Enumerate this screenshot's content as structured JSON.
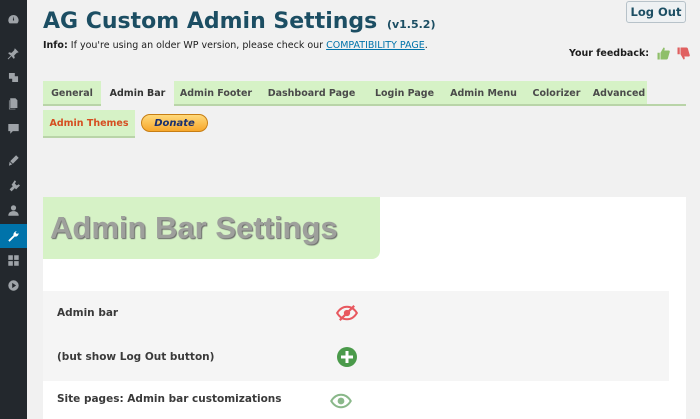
{
  "header": {
    "title": "AG Custom Admin Settings",
    "version": "(v1.5.2)",
    "info_label": "Info:",
    "info_text": " If you're using an older WP version, please check our ",
    "compat_link": "COMPATIBILITY PAGE",
    "info_end": ".",
    "logout_label": "Log Out",
    "feedback_label": "Your feedback:"
  },
  "sidebar": {
    "icons": [
      "dashboard-icon",
      "pin-icon",
      "media-icon",
      "pages-icon",
      "comments-icon",
      "appearance-icon",
      "plugins-icon",
      "users-icon",
      "tools-icon",
      "settings-icon",
      "play-icon"
    ],
    "active": "tools-icon"
  },
  "tabs": [
    {
      "label": "General"
    },
    {
      "label": "Admin Bar"
    },
    {
      "label": "Admin Footer"
    },
    {
      "label": "Dashboard Page"
    },
    {
      "label": "Login Page"
    },
    {
      "label": "Admin Menu"
    },
    {
      "label": "Colorizer"
    },
    {
      "label": "Advanced"
    }
  ],
  "active_tab": "Admin Bar",
  "tab_admin_themes": "Admin Themes",
  "donate_label": "Donate",
  "main": {
    "section_title": "Admin Bar Settings",
    "rows": [
      {
        "label": "Admin bar",
        "control": "hidden-eye-icon",
        "state": "hidden"
      },
      {
        "label": "(but show Log Out button)",
        "control": "plus-circle-icon",
        "state": "enabled"
      },
      {
        "label": "Site pages: Admin bar customizations",
        "control": "eye-icon",
        "state": "visible"
      }
    ]
  },
  "colors": {
    "accent_green": "#d6f2c6",
    "title_blue": "#1c4e63",
    "themes_orange": "#d54e21",
    "hidden_red": "#e8585f",
    "enabled_green": "#4a9a4a",
    "eye_green": "#8ab88a"
  }
}
